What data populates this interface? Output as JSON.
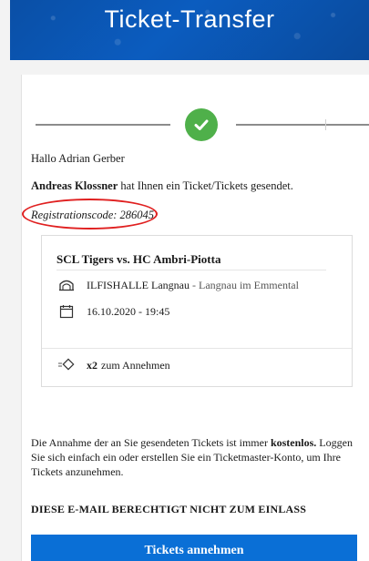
{
  "header": {
    "title": "Ticket-Transfer"
  },
  "message": {
    "greeting": "Hallo Adrian Gerber",
    "sender_name": "Andreas Klossner",
    "sender_text": " hat Ihnen ein Ticket/Tickets gesendet.",
    "registration_label": "Registrationscode: 286045"
  },
  "event": {
    "title": "SCL Tigers vs. HC Ambri-Piotta",
    "venue_name": "ILFISHALLE Langnau",
    "venue_separator": " - ",
    "venue_city": "Langnau im Emmental",
    "datetime": "16.10.2020 - 19:45",
    "quantity": "x2",
    "quantity_text": "zum Annehmen"
  },
  "info": {
    "part1": "Die Annahme der an Sie gesendeten Tickets ist immer ",
    "bold": "kostenlos.",
    "part2": " Loggen Sie sich einfach ein oder erstellen Sie ein Ticketmaster-Konto, um Ihre Tickets anzunehmen."
  },
  "notice": "DIESE E-MAIL BERECHTIGT NICHT ZUM EINLASS",
  "cta": {
    "label": "Tickets annehmen"
  },
  "colors": {
    "header": "#0b5cbf",
    "button": "#0a6fd6",
    "check": "#4fb04a",
    "annotation": "#e02020"
  }
}
